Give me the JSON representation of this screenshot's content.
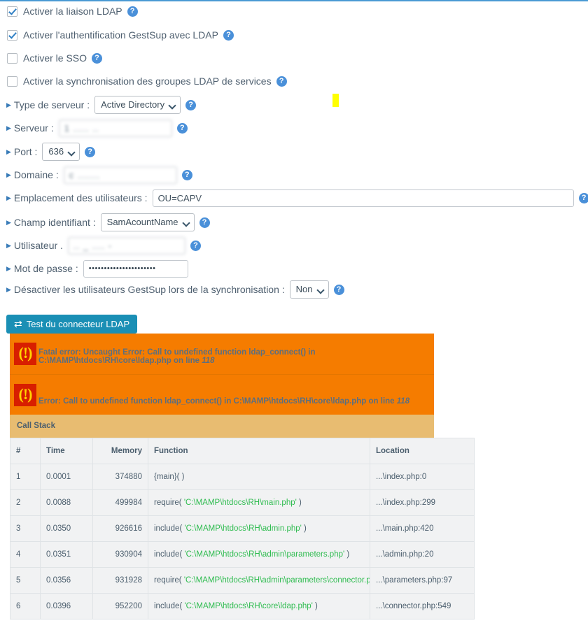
{
  "checkboxes": [
    {
      "label": "Activer la liaison LDAP",
      "checked": true,
      "name": "enable-ldap-link"
    },
    {
      "label": "Activer l'authentification GestSup avec LDAP",
      "checked": true,
      "name": "enable-gestsup-auth"
    },
    {
      "label": "Activer le SSO",
      "checked": false,
      "name": "enable-sso"
    },
    {
      "label": "Activer la synchronisation des groupes LDAP de services",
      "checked": false,
      "name": "enable-group-sync"
    }
  ],
  "fields": {
    "server_type": {
      "label": "Type de serveur :",
      "value": "Active Directory"
    },
    "server": {
      "label": "Serveur :",
      "value": "1      ..... ..",
      "redacted": true
    },
    "port": {
      "label": "Port :",
      "value": "636"
    },
    "domain": {
      "label": "Domaine :",
      "value": "c   .......",
      "redacted": true
    },
    "user_location": {
      "label": "Emplacement des utilisateurs :",
      "value": "OU=CAPV"
    },
    "id_field": {
      "label": "Champ identifiant :",
      "value": "SamAcountName"
    },
    "user": {
      "label": "Utilisateur .",
      "value": ".. _   .... -",
      "redacted": true
    },
    "password": {
      "label": "Mot de passe :",
      "value": "••••••••••••••••••••••"
    },
    "disable_users": {
      "label": "Désactiver les utilisateurs GestSup lors de la synchronisation :",
      "value": "Non"
    }
  },
  "test_button": {
    "label": "Test du connecteur LDAP",
    "icon": "exchange-arrows-icon"
  },
  "errors": [
    {
      "text": "Fatal error: Uncaught Error: Call to undefined function ldap_connect() in C:\\MAMP\\htdocs\\RH\\core\\ldap.php on line ",
      "line": "118"
    },
    {
      "text": "Error: Call to undefined function ldap_connect() in C:\\MAMP\\htdocs\\RH\\core\\ldap.php on line ",
      "line": "118"
    }
  ],
  "call_stack": {
    "title": "Call Stack",
    "columns": [
      "#",
      "Time",
      "Memory",
      "Function",
      "Location"
    ],
    "rows": [
      {
        "n": "1",
        "time": "0.0001",
        "memory": "374880",
        "fn_pre": "{main}( )",
        "fn_str": "",
        "fn_post": "",
        "location": "...\\index.php:0"
      },
      {
        "n": "2",
        "time": "0.0088",
        "memory": "499984",
        "fn_pre": "require( ",
        "fn_str": "'C:\\MAMP\\htdocs\\RH\\main.php'",
        "fn_post": " )",
        "location": "...\\index.php:299"
      },
      {
        "n": "3",
        "time": "0.0350",
        "memory": "926616",
        "fn_pre": "include( ",
        "fn_str": "'C:\\MAMP\\htdocs\\RH\\admin.php'",
        "fn_post": " )",
        "location": "...\\main.php:420"
      },
      {
        "n": "4",
        "time": "0.0351",
        "memory": "930904",
        "fn_pre": "include( ",
        "fn_str": "'C:\\MAMP\\htdocs\\RH\\admin\\parameters.php'",
        "fn_post": " )",
        "location": "...\\admin.php:20"
      },
      {
        "n": "5",
        "time": "0.0356",
        "memory": "931928",
        "fn_pre": "require( ",
        "fn_str": "'C:\\MAMP\\htdocs\\RH\\admin\\parameters\\connector.php'",
        "fn_post": " )",
        "location": "...\\parameters.php:97"
      },
      {
        "n": "6",
        "time": "0.0396",
        "memory": "952200",
        "fn_pre": "include( ",
        "fn_str": "'C:\\MAMP\\htdocs\\RH\\core\\ldap.php'",
        "fn_post": " )",
        "location": "...\\connector.php:549"
      }
    ]
  },
  "colors": {
    "accent_blue": "#4a90d9",
    "button_teal": "#1a8fb5",
    "error_orange": "#f57c00",
    "error_icon_red": "#d81e00",
    "callstack_header": "#e8bc71",
    "highlight_yellow": "#ffff00"
  }
}
